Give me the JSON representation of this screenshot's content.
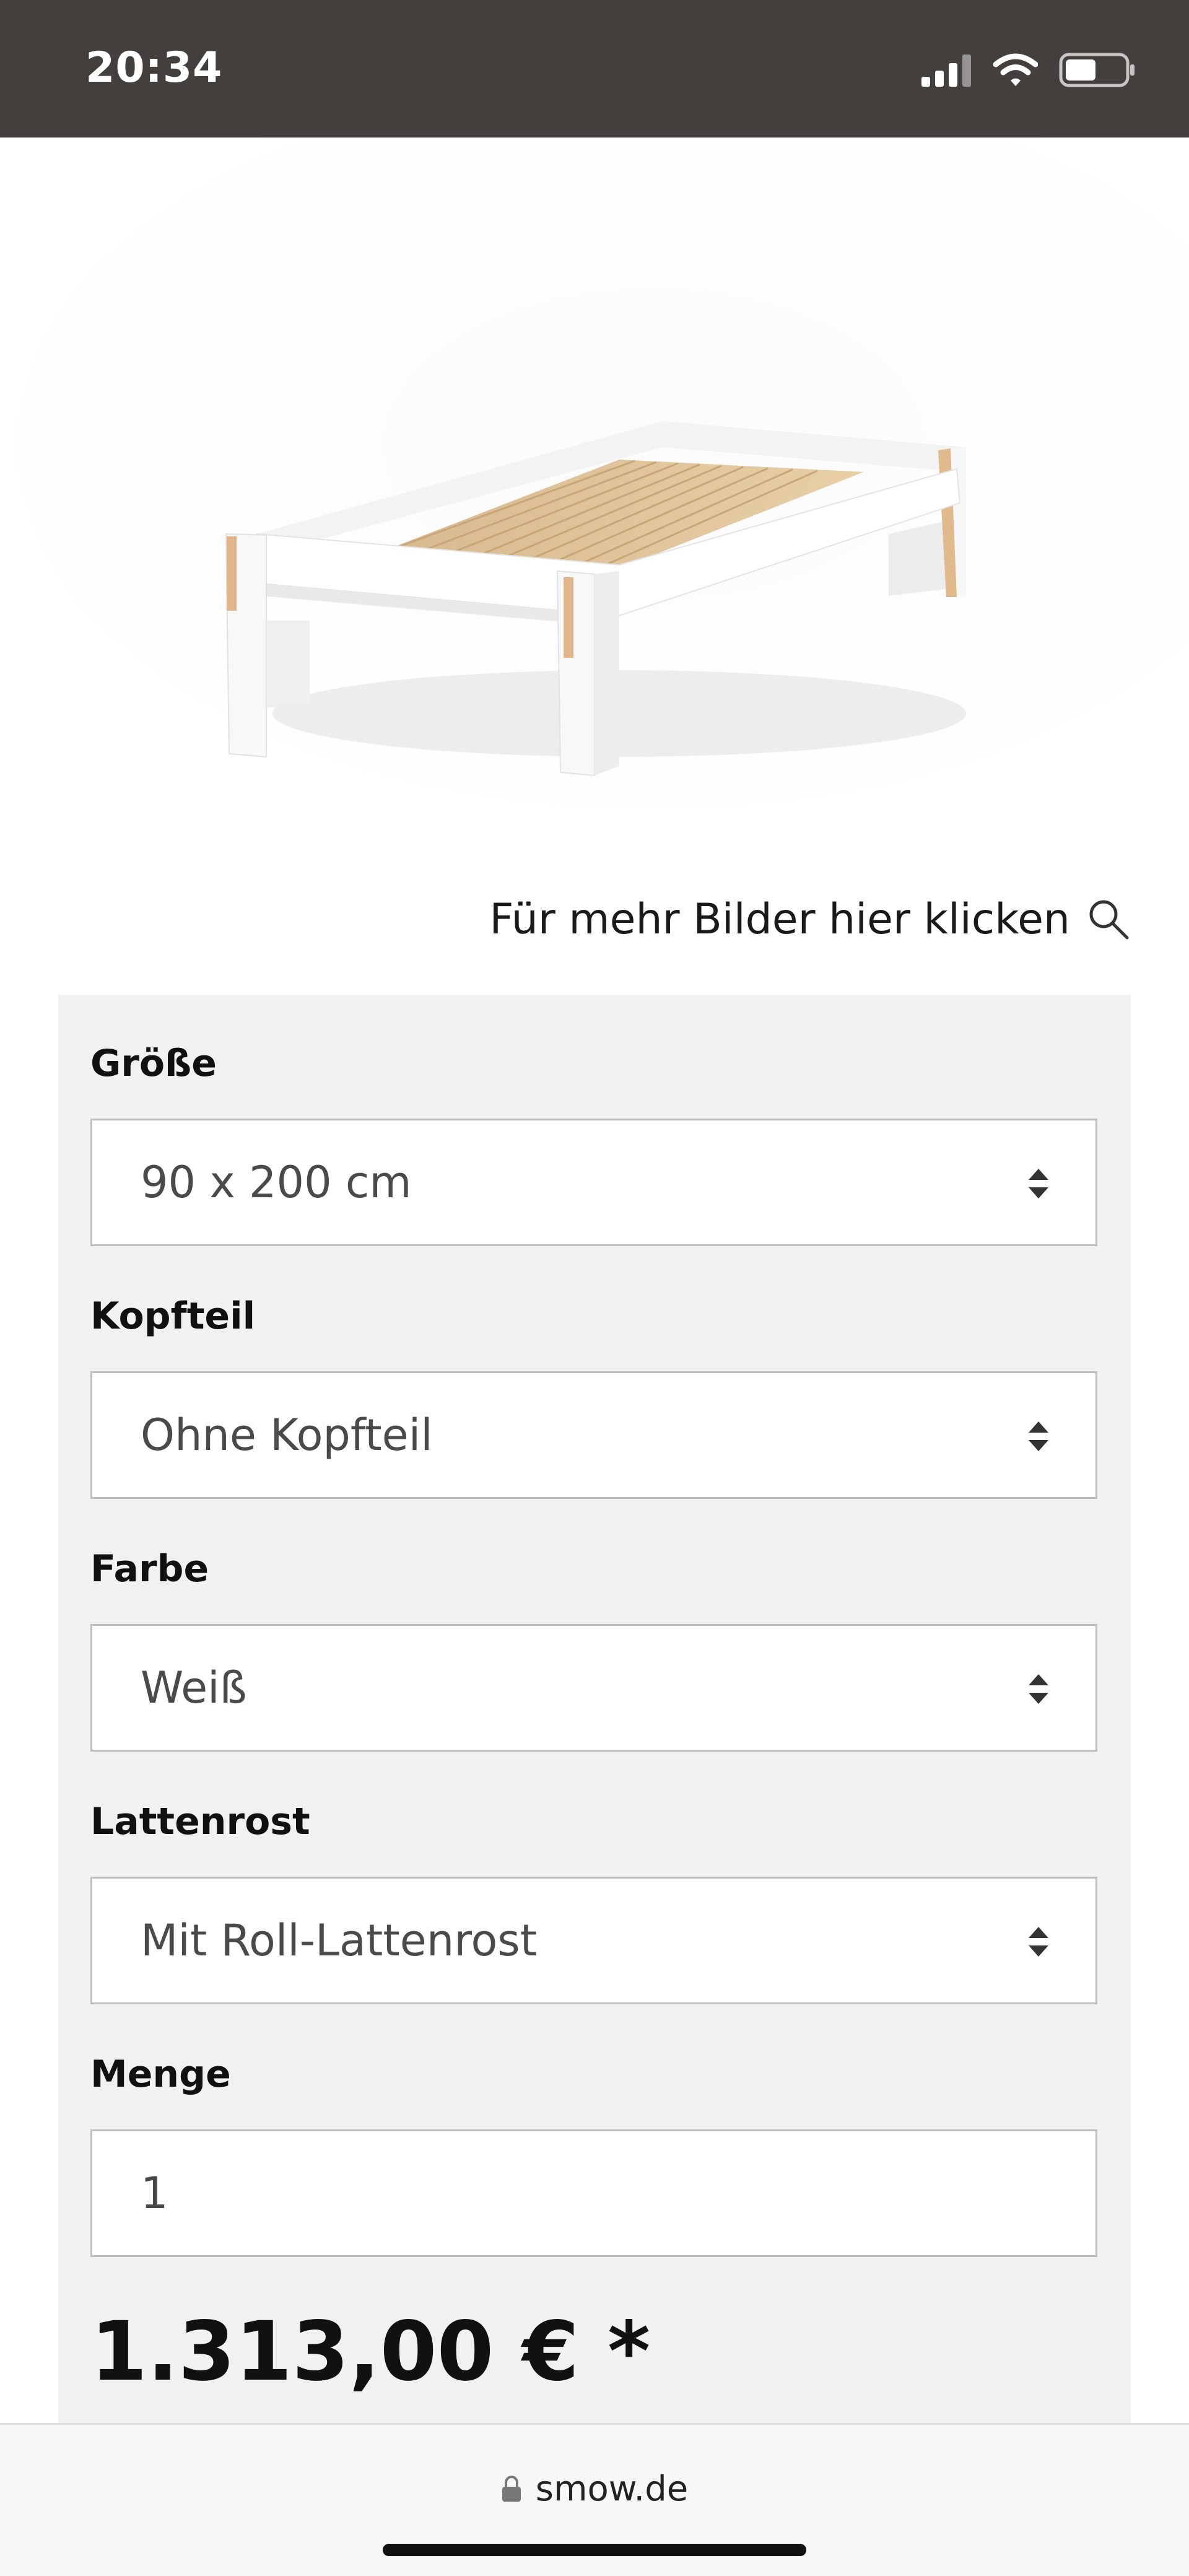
{
  "status_bar": {
    "time": "20:34",
    "icons": [
      "cellular-signal-icon",
      "wifi-icon",
      "battery-icon"
    ],
    "background": "#433f3d"
  },
  "product_image": {
    "icon": "bed-product-image"
  },
  "gallery_link": {
    "label": "Für mehr Bilder hier klicken",
    "icon": "search-icon"
  },
  "options": [
    {
      "label": "Größe",
      "value": "90 x 200 cm"
    },
    {
      "label": "Kopfteil",
      "value": "Ohne Kopfteil"
    },
    {
      "label": "Farbe",
      "value": "Weiß"
    },
    {
      "label": "Lattenrost",
      "value": "Mit Roll-Lattenrost"
    }
  ],
  "quantity": {
    "label": "Menge",
    "value": "1"
  },
  "price": "1.313,00 € *",
  "browser": {
    "url": "smow.de",
    "icon": "lock-icon"
  },
  "colors": {
    "panel_background": "#f1f1f1",
    "field_border": "#bdbdbd",
    "text": "#111111"
  }
}
